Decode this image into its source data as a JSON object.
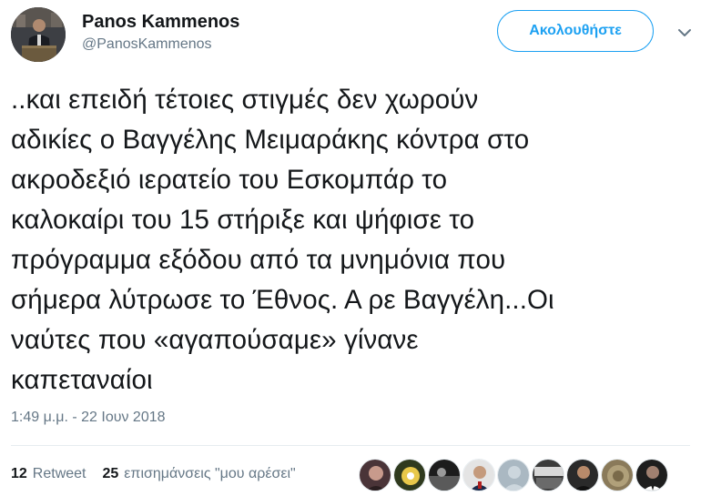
{
  "profile": {
    "display_name": "Panos Kammenos",
    "handle": "@PanosKammenos",
    "follow_label": "Ακολουθήστε"
  },
  "tweet": {
    "text": "..και επειδή τέτοιες στιγμές δεν χωρούν\nαδικίες ο Βαγγέλης Μειμαράκης κόντρα στο\nακροδεξιό ιερατείο του Εσκομπάρ το\nκαλοκαίρι του 15 στήριξε και ψήφισε το\nπρόγραμμα εξόδου από τα μνημόνια που\nσήμερα λύτρωσε το Έθνος. Α ρε Βαγγέλη...Οι\nναύτες που «αγαπούσαμε» γίνανε\nκαπεταναίοι",
    "timestamp": "1:49 μ.μ. - 22 Ιουν 2018"
  },
  "stats": {
    "retweets_count": "12",
    "retweets_label": "Retweet",
    "likes_count": "25",
    "likes_label": "επισημάνσεις \"μου αρέσει\""
  },
  "likers": [
    {
      "name": "liker-avatar-1",
      "color": "#3a2a2e"
    },
    {
      "name": "liker-avatar-2",
      "color": "#2f3a1e"
    },
    {
      "name": "liker-avatar-3",
      "color": "#202020"
    },
    {
      "name": "liker-avatar-4",
      "color": "#c9c9c9"
    },
    {
      "name": "liker-avatar-5",
      "color": "#aab8c2"
    },
    {
      "name": "liker-avatar-6",
      "color": "#3b3b3b"
    },
    {
      "name": "liker-avatar-7",
      "color": "#2a2a2a"
    },
    {
      "name": "liker-avatar-8",
      "color": "#8a7a5a"
    },
    {
      "name": "liker-avatar-9",
      "color": "#1e1e1e"
    }
  ],
  "colors": {
    "accent": "#1da1f2",
    "secondary_text": "#657786",
    "primary_text": "#14171a"
  }
}
